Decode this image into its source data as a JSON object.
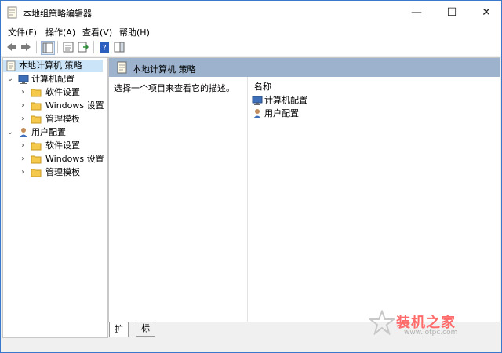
{
  "window": {
    "title": "本地组策略编辑器",
    "minimize": "—",
    "maximize": "☐",
    "close": "✕"
  },
  "menu": [
    "文件(F)",
    "操作(A)",
    "查看(V)",
    "帮助(H)"
  ],
  "tree": {
    "root": "本地计算机 策略",
    "computer": {
      "label": "计算机配置",
      "children": [
        "软件设置",
        "Windows 设置",
        "管理模板"
      ]
    },
    "user": {
      "label": "用户配置",
      "children": [
        "软件设置",
        "Windows 设置",
        "管理模板"
      ]
    }
  },
  "pane": {
    "header": "本地计算机 策略",
    "description": "选择一个项目来查看它的描述。",
    "column_name": "名称",
    "items": [
      "计算机配置",
      "用户配置"
    ]
  },
  "tabs": [
    "扩展",
    "标准"
  ],
  "watermark": {
    "brand": "装机之家",
    "url": "www.lotpc.com"
  }
}
